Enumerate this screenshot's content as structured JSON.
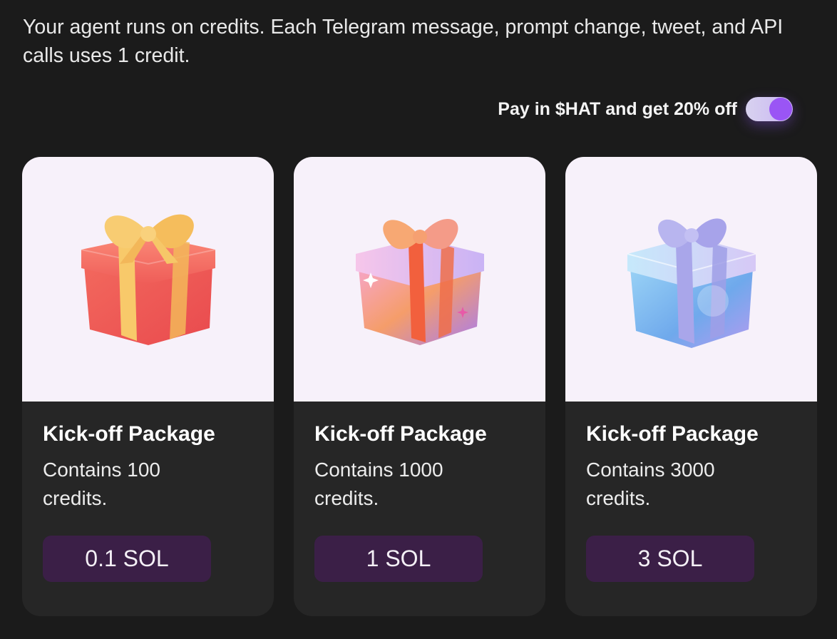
{
  "intro_text": "Your agent runs on credits. Each Telegram message, prompt change, tweet, and API calls uses 1 credit.",
  "promo": {
    "label": "Pay in $HAT and get 20% off",
    "toggle_on": true
  },
  "colors": {
    "background": "#1b1b1b",
    "card": "#262626",
    "card_media": "#f7f1fa",
    "price_button": "#3b1f47",
    "toggle_knob": "#9a55f5"
  },
  "packages": [
    {
      "title": "Kick-off Package",
      "description": "Contains 100 credits.",
      "price": "0.1 SOL",
      "icon": "red-gift-box-icon"
    },
    {
      "title": "Kick-off Package",
      "description": "Contains 1000 credits.",
      "price": "1 SOL",
      "icon": "iridescent-gift-box-icon"
    },
    {
      "title": "Kick-off Package",
      "description": "Contains 3000 credits.",
      "price": "3 SOL",
      "icon": "blue-crystal-gift-box-icon"
    }
  ]
}
